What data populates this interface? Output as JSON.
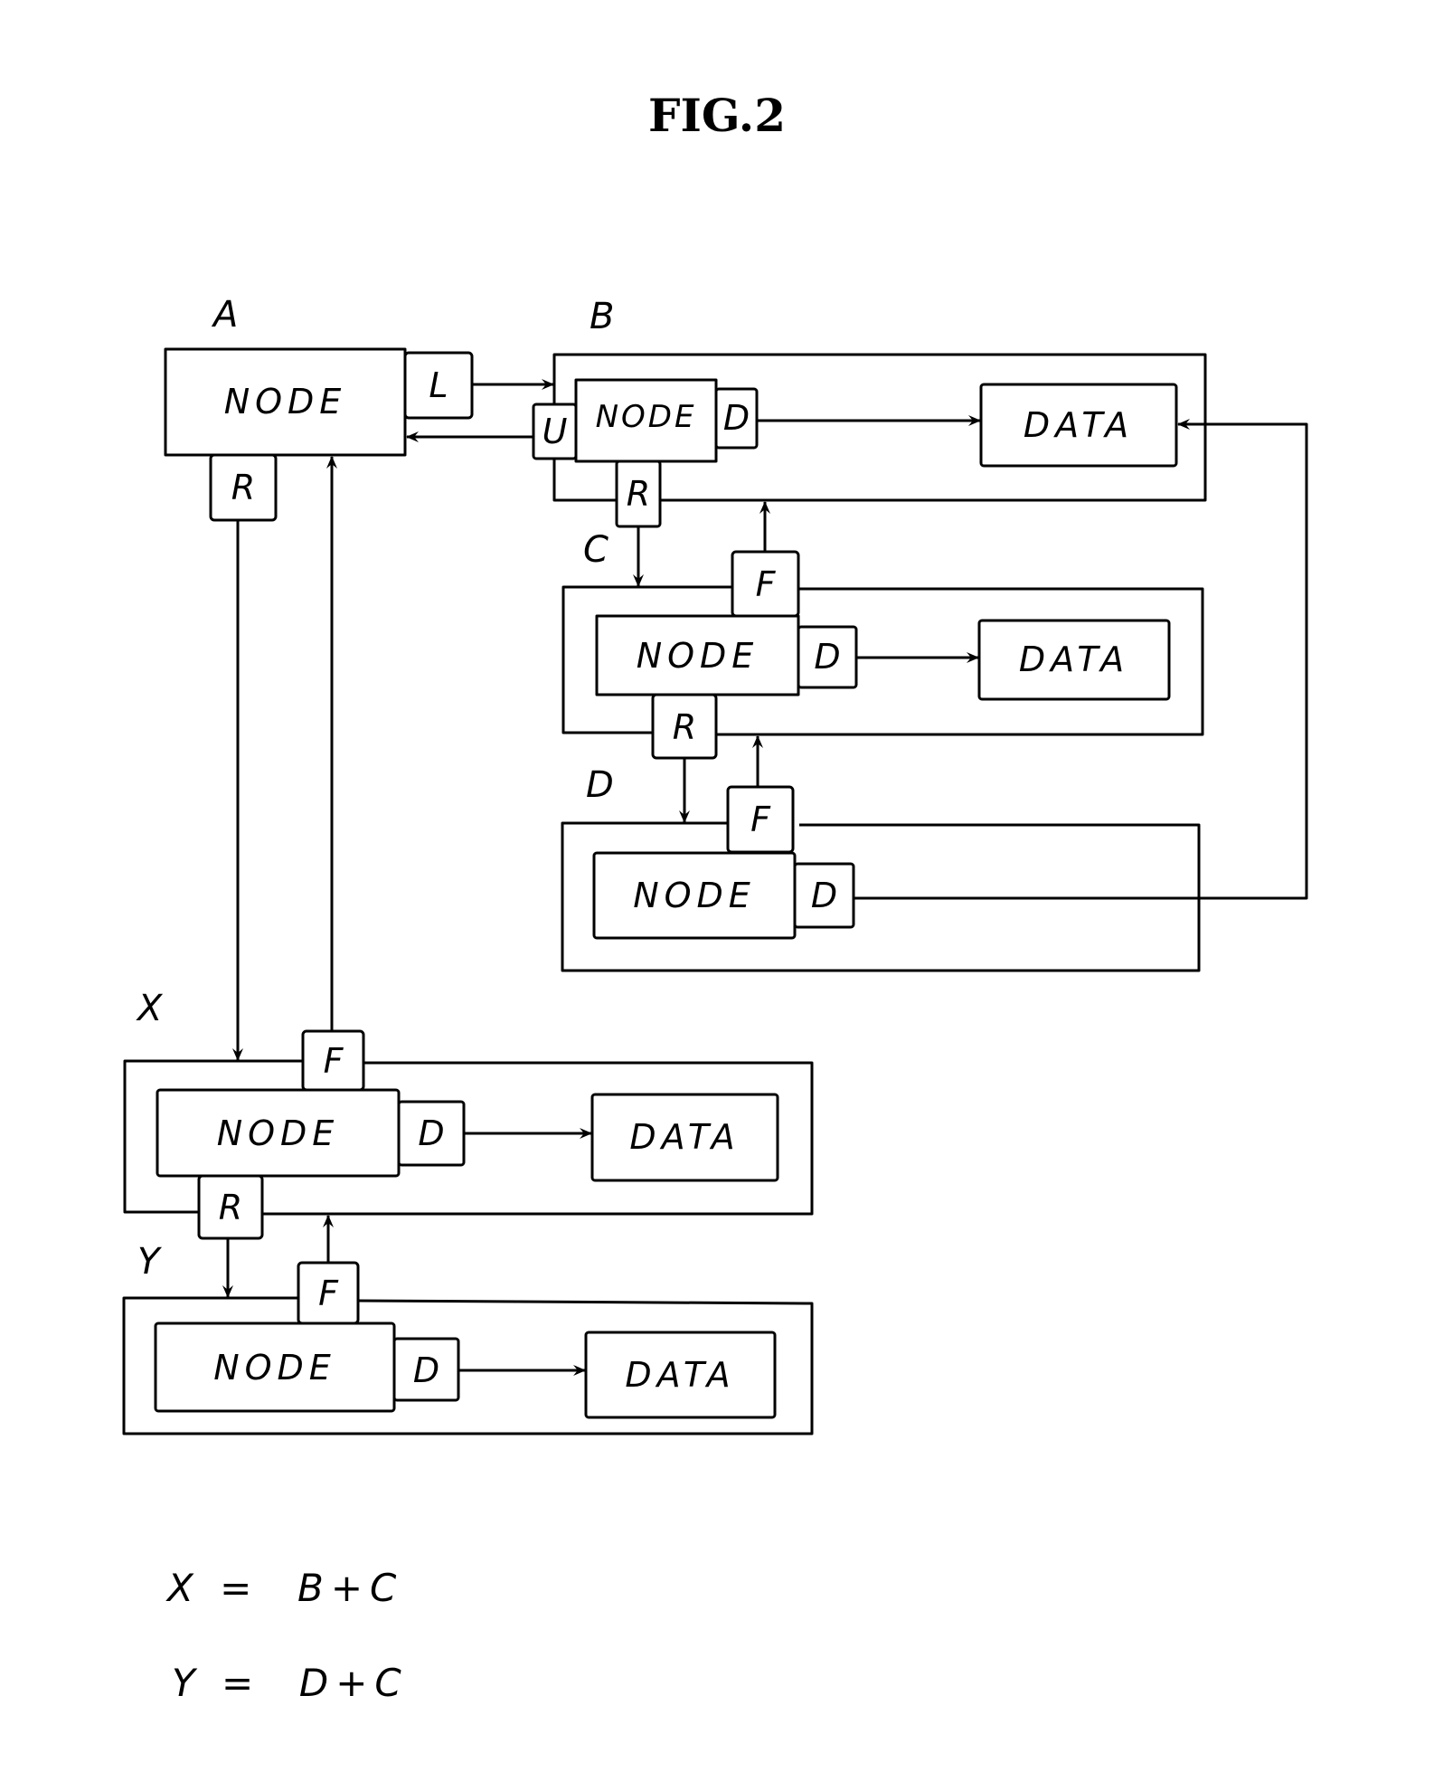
{
  "figure": {
    "title": "FIG.2"
  },
  "groups": {
    "A": {
      "label": "A",
      "node": "NODE",
      "ports": {
        "L": "L",
        "R": "R"
      }
    },
    "B": {
      "label": "B",
      "node": "NODE",
      "data": "DATA",
      "ports": {
        "U": "U",
        "D": "D",
        "R": "R"
      }
    },
    "C": {
      "label": "C",
      "node": "NODE",
      "data": "DATA",
      "ports": {
        "F": "F",
        "D": "D",
        "R": "R"
      }
    },
    "D": {
      "label": "D",
      "node": "NODE",
      "ports": {
        "F": "F",
        "D": "D"
      }
    },
    "X": {
      "label": "X",
      "node": "NODE",
      "data": "DATA",
      "ports": {
        "F": "F",
        "D": "D",
        "R": "R"
      }
    },
    "Y": {
      "label": "Y",
      "node": "NODE",
      "data": "DATA",
      "ports": {
        "F": "F",
        "D": "D"
      }
    }
  },
  "equations": [
    "X =  B+C",
    "Y =  D+C"
  ],
  "colors": {
    "ink": "#000000",
    "paper": "#ffffff"
  }
}
